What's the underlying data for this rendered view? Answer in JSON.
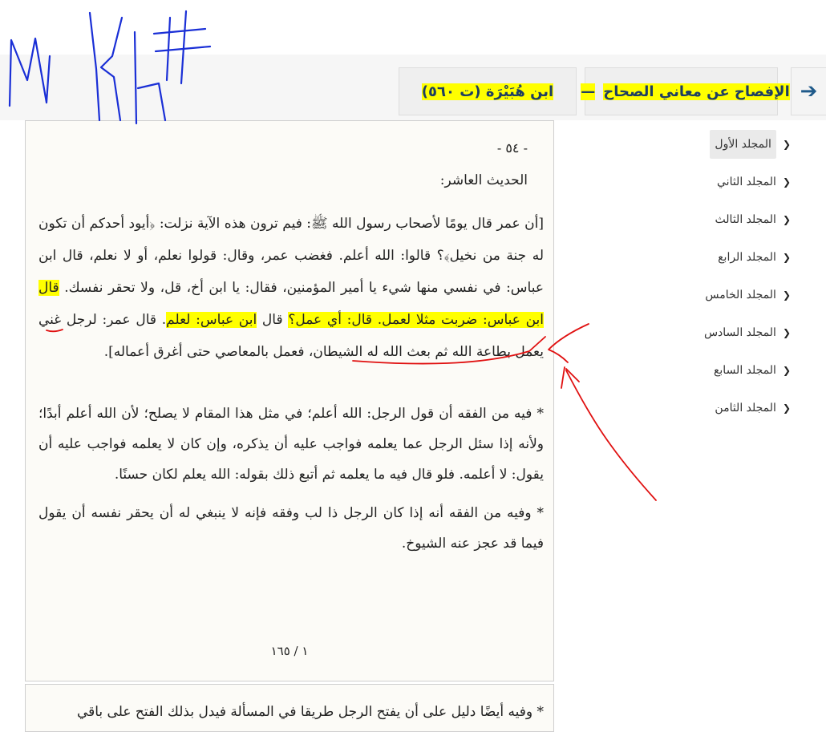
{
  "header": {
    "back_arrow": "➔",
    "book_title": "الإفصاح عن معاني الصحاح",
    "separator": "—",
    "author": "ابن هُبَيْرَة (ت ٥٦٠)"
  },
  "sidebar": {
    "items": [
      {
        "label": "المجلد الأول",
        "active": true
      },
      {
        "label": "المجلد الثاني"
      },
      {
        "label": "المجلد الثالث"
      },
      {
        "label": "المجلد الرابع"
      },
      {
        "label": "المجلد الخامس"
      },
      {
        "label": "المجلد السادس"
      },
      {
        "label": "المجلد السابع"
      },
      {
        "label": "المجلد الثامن"
      }
    ]
  },
  "page": {
    "page_marker": "- ٥٤ -",
    "hadith_title": "الحديث العاشر:",
    "para1_a": "[أن عمر قال يومًا لأصحاب رسول الله ﷺ: فيم ترون هذه الآية نزلت: ﴿أيود أحدكم أن تكون له جنة من نخيل﴾؟ قالوا: الله أعلم. فغضب عمر، وقال: قولوا نعلم، أو لا نعلم، قال ابن عباس: في نفسي منها شيء يا أمير المؤمنين، فقال: يا ابن أخ، قل، ولا تحقر نفسك.",
    "para1_hl1": "قال ابن عباس: ضربت مثلا لعمل. قال: أي عمل؟",
    "para1_b": "قال",
    "para1_hl2": "ابن عباس: لعلم",
    "para1_c": ". قال عمر: لرجل غني يعمل بطاعة الله ثم بعث الله له الشيطان، فعمل بالمعاصي حتى أغرق أعماله].",
    "para2": "* فيه من الفقه أن قول الرجل: الله أعلم؛ في مثل هذا المقام لا يصلح؛ لأن الله أعلم أبدًا؛ ولأنه إذا سئل الرجل عما يعلمه فواجب عليه أن يذكره، وإن كان لا يعلمه فواجب عليه أن يقول: لا أعلمه. فلو قال فيه ما يعلمه ثم أتبع ذلك بقوله: الله يعلم لكان حسنًا.",
    "para3": "* وفيه من الفقه أنه إذا كان الرجل ذا لب وفقه فإنه لا ينبغي له أن يحقر نفسه أن يقول فيما قد عجز عنه الشيوخ.",
    "footer": "١ / ١٦٥"
  },
  "page_next": {
    "para": "* وفيه أيضًا دليل على أن يفتح الرجل طريقا في المسألة فيدل بذلك الفتح على باقي"
  },
  "colors": {
    "highlight": "#ffff00",
    "ink_blue": "#1a2fd6",
    "ink_red": "#e01010",
    "title_text": "#1e3e62"
  }
}
